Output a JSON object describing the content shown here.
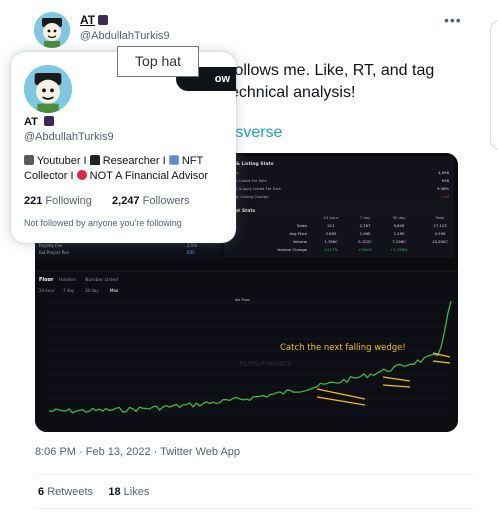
{
  "author": {
    "name": "AT",
    "handle": "@AbdullahTurkis9",
    "hat_icon": "top-hat-emoji"
  },
  "tweet": {
    "text_line1": "follows me. Like, RT, and tag",
    "text_line2": "echnical analysis!",
    "link_fragment": "rsverse",
    "timestamp": "8:06 PM · Feb 13, 2022 · Twitter Web App",
    "retweets_count": "6",
    "retweets_label": "Retweets",
    "likes_count": "18",
    "likes_label": "Likes"
  },
  "hovercard": {
    "name": "AT",
    "handle": "@AbdullahTurkis9",
    "follow_label": "ow",
    "bio_part1": "Youtuber I",
    "bio_part2": "Researcher I",
    "bio_part3": "NFT",
    "bio_part4": "Collector I",
    "bio_part5": "NOT A Financial Advisor",
    "following_count": "221",
    "following_label": "Following",
    "followers_count": "2,247",
    "followers_label": "Followers",
    "note": "Not followed by anyone you're following"
  },
  "tooltip": {
    "text": "Top hat"
  },
  "media": {
    "top_panel_title": "ter & Listing Stats",
    "market_title": "arket Stats",
    "left_rows": [
      "Royalty Fee",
      "Ext Project Rev"
    ],
    "left_values": [
      "2.5%",
      "ERC"
    ],
    "col_headers": [
      "24 hour",
      "7 day",
      "30 day",
      "Total"
    ],
    "row_labels": [
      "Sales",
      "Avg Price",
      "Volume",
      "Volume Change"
    ],
    "row_values": [
      [
        "511",
        "2,767",
        "6,826",
        "17,113"
      ],
      [
        "2.89S",
        "1.96S",
        "1.29S",
        "0.59S"
      ],
      [
        "1,786C",
        "5,152C",
        "7,298C",
        "10,200C"
      ],
      [
        "+217%",
        "+300%",
        "+1,758%",
        ""
      ]
    ],
    "stats_rows": [
      "olders",
      "count Listed For Sale",
      "count Supply Listed For Sale",
      "in Day Listing Change"
    ],
    "stats_values": [
      "4,956",
      "936",
      "9.36%",
      "+10"
    ],
    "tabs": [
      "Floor",
      "Holders",
      "Number Listed"
    ],
    "ranges": [
      "24 hour",
      "7 day",
      "30 day",
      "Max"
    ],
    "chart_small_title": "ale Floor",
    "annotation": "Catch the next falling wedge!",
    "watermark": "FLIPS.FINANCE",
    "colors": {
      "line": "#3ab54a",
      "wedge": "#f2c200",
      "annotation": "#f2c200",
      "positive": "#3ab54a"
    }
  }
}
